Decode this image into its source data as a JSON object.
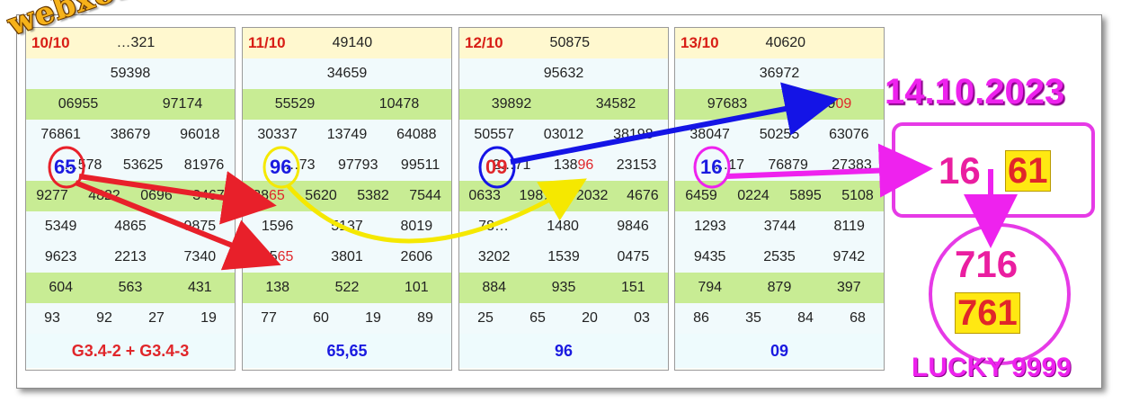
{
  "watermark": "webxoso.net",
  "panels": [
    {
      "date": "10/10",
      "head_value": "…321",
      "rows": [
        [
          "59398"
        ],
        [
          "06955",
          "97174"
        ],
        [
          "76861",
          "38679",
          "96018"
        ],
        [
          "…578",
          "53625",
          "81976"
        ],
        [
          "9277",
          "4822",
          "0696",
          "3467"
        ],
        [
          "5349",
          "4865",
          "9875"
        ],
        [
          "9623",
          "2213",
          "7340"
        ],
        [
          "604",
          "563",
          "431"
        ],
        [
          "93",
          "92",
          "27",
          "19"
        ]
      ],
      "circle_digits": "65",
      "footer": "G3.4-2 + G3.4-3"
    },
    {
      "date": "11/10",
      "head_value": "49140",
      "rows": [
        [
          "34659"
        ],
        [
          "55529",
          "10478"
        ],
        [
          "30337",
          "13749",
          "64088"
        ],
        [
          "…73",
          "97793",
          "99511"
        ],
        [
          "38",
          "5620",
          "5382",
          "7544"
        ],
        [
          "1596",
          "5137",
          "8019"
        ],
        [
          "25",
          "3801",
          "2606"
        ],
        [
          "138",
          "522",
          "101"
        ],
        [
          "77",
          "60",
          "19",
          "89"
        ]
      ],
      "circle_digits": "96",
      "hl_a": "65",
      "hl_b": "65",
      "footer": "65,65"
    },
    {
      "date": "12/10",
      "head_value": "50875",
      "rows": [
        [
          "95632"
        ],
        [
          "39892",
          "34582"
        ],
        [
          "50557",
          "03012",
          "38198"
        ],
        [
          "2…71",
          "138",
          "23153"
        ],
        [
          "0633",
          "198…",
          "2032",
          "4676"
        ],
        [
          "78…",
          "1480",
          "9846"
        ],
        [
          "3202",
          "1539",
          "0475"
        ],
        [
          "884",
          "935",
          "151"
        ],
        [
          "25",
          "65",
          "20",
          "03"
        ]
      ],
      "circle_digits": "09",
      "hl_c": "96",
      "footer": "96"
    },
    {
      "date": "13/10",
      "head_value": "40620",
      "rows": [
        [
          "36972"
        ],
        [
          "97683",
          "999"
        ],
        [
          "38047",
          "50255",
          "63076"
        ],
        [
          "…17",
          "76879",
          "27383"
        ],
        [
          "6459",
          "0224",
          "5895",
          "5108"
        ],
        [
          "1293",
          "3744",
          "8119"
        ],
        [
          "9435",
          "2535",
          "9742"
        ],
        [
          "794",
          "879",
          "397"
        ],
        [
          "86",
          "35",
          "84",
          "68"
        ]
      ],
      "circle_digits": "16",
      "hl_d": "09",
      "footer": "09"
    }
  ],
  "prediction": {
    "date": "14.10.2023",
    "first_plain": "16",
    "first_hl": "61",
    "second_plain": "716",
    "second_hl": "761",
    "signature": "LUCKY 9999"
  },
  "colors": {
    "red": "#e0262a",
    "blue": "#1a1ae0",
    "magenta": "#ee22ee",
    "yellow": "#ffe812",
    "green_row": "#c8ec94"
  }
}
